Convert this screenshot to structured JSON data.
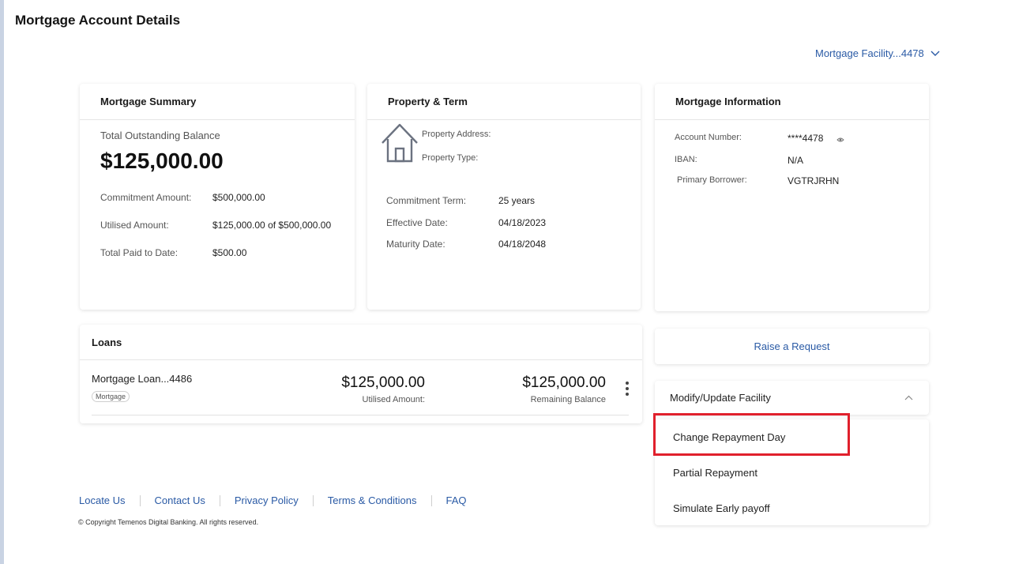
{
  "page": {
    "title": "Mortgage Account Details"
  },
  "facility_select": {
    "label": "Mortgage Facility...4478",
    "icon": "chevron-down-icon"
  },
  "summary": {
    "header": "Mortgage Summary",
    "balance_label": "Total Outstanding Balance",
    "balance_value": "$125,000.00",
    "rows": [
      {
        "label": "Commitment Amount:",
        "value": "$500,000.00"
      },
      {
        "label": "Utilised Amount:",
        "value": "$125,000.00 of $500,000.00"
      },
      {
        "label": "Total Paid to Date:",
        "value": "$500.00"
      }
    ]
  },
  "property": {
    "header": "Property & Term",
    "icon": "house-icon",
    "address_label": "Property Address:",
    "type_label": "Property Type:",
    "rows": [
      {
        "label": "Commitment Term:",
        "value": "25 years"
      },
      {
        "label": "Effective Date:",
        "value": "04/18/2023"
      },
      {
        "label": "Maturity Date:",
        "value": "04/18/2048"
      }
    ]
  },
  "info": {
    "header": "Mortgage Information",
    "rows": [
      {
        "label": "Account Number:",
        "value": "****4478"
      },
      {
        "label": "IBAN:",
        "value": "N/A"
      },
      {
        "label": "Primary Borrower:",
        "value": "VGTRJRHN"
      }
    ],
    "eye_icon": "eye-icon"
  },
  "loans": {
    "header": "Loans",
    "items": [
      {
        "name": "Mortgage Loan...4486",
        "tag": "Mortgage",
        "utilised_value": "$125,000.00",
        "utilised_label": "Utilised Amount:",
        "remaining_value": "$125,000.00",
        "remaining_label": "Remaining Balance"
      }
    ]
  },
  "actions": {
    "raise_request": "Raise a Request",
    "modify_header": "Modify/Update Facility",
    "modify_items": [
      "Change Repayment Day",
      "Partial Repayment",
      "Simulate Early payoff"
    ]
  },
  "footer": {
    "links": [
      "Locate Us",
      "Contact Us",
      "Privacy Policy",
      "Terms & Conditions",
      "FAQ"
    ],
    "copyright": "© Copyright Temenos Digital Banking. All rights reserved."
  },
  "colors": {
    "link": "#2a5aa5",
    "highlight": "#e0202c"
  }
}
